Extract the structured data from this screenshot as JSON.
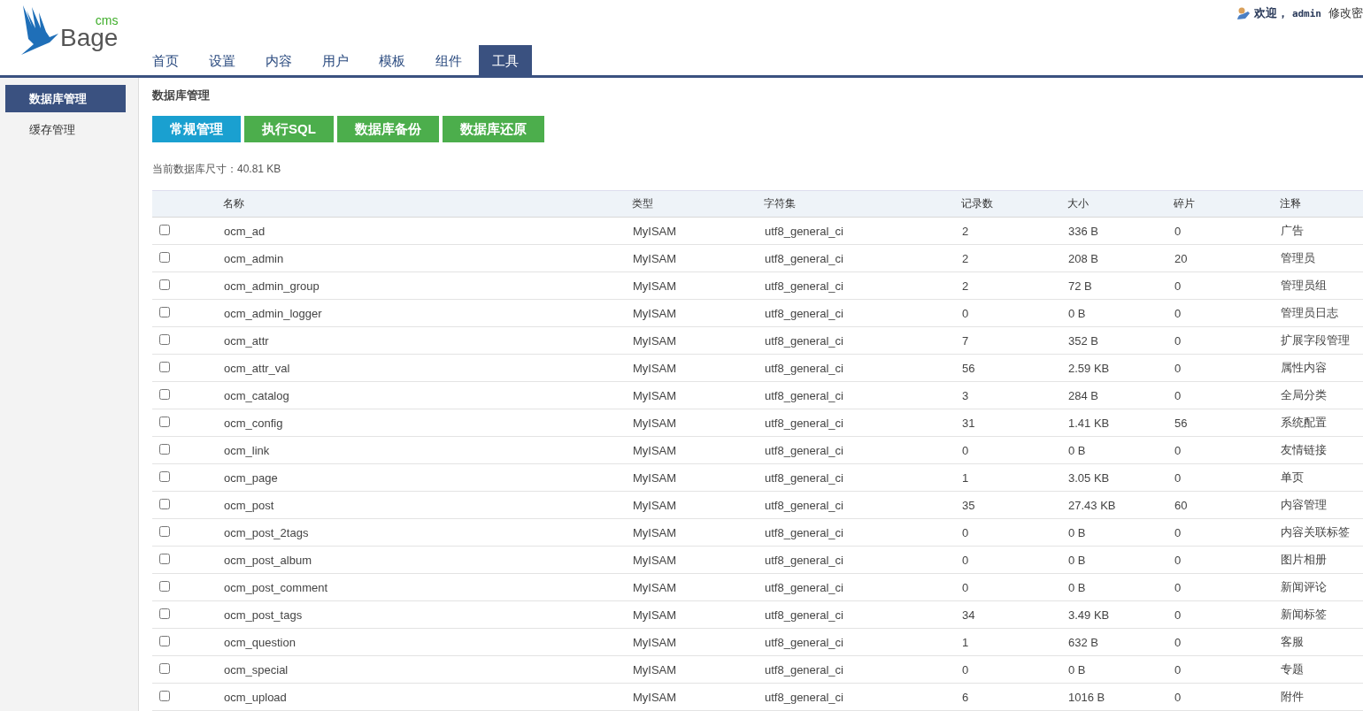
{
  "logo": {
    "text": "Bage",
    "suffix": "cms"
  },
  "user_bar": {
    "greeting": "欢迎，",
    "user": "admin",
    "link": "修改密"
  },
  "nav": [
    {
      "label": "首页",
      "selected": false
    },
    {
      "label": "设置",
      "selected": false
    },
    {
      "label": "内容",
      "selected": false
    },
    {
      "label": "用户",
      "selected": false
    },
    {
      "label": "模板",
      "selected": false
    },
    {
      "label": "组件",
      "selected": false
    },
    {
      "label": "工具",
      "selected": true
    }
  ],
  "sidebar": {
    "items": [
      {
        "label": "数据库管理",
        "selected": true
      },
      {
        "label": "缓存管理",
        "selected": false
      }
    ]
  },
  "page_title": "数据库管理",
  "actions": [
    {
      "label": "常规管理",
      "selected": true
    },
    {
      "label": "执行SQL",
      "selected": false
    },
    {
      "label": "数据库备份",
      "selected": false
    },
    {
      "label": "数据库还原",
      "selected": false
    }
  ],
  "db_size": "当前数据库尺寸：40.81 KB",
  "table": {
    "columns": [
      "名称",
      "类型",
      "字符集",
      "记录数",
      "大小",
      "碎片",
      "注释"
    ],
    "rows": [
      {
        "checked": false,
        "cells": [
          "ocm_ad",
          "MyISAM",
          "utf8_general_ci",
          "2",
          "336 B",
          "0",
          "广告"
        ]
      },
      {
        "checked": false,
        "cells": [
          "ocm_admin",
          "MyISAM",
          "utf8_general_ci",
          "2",
          "208 B",
          "20",
          "管理员"
        ]
      },
      {
        "checked": false,
        "cells": [
          "ocm_admin_group",
          "MyISAM",
          "utf8_general_ci",
          "2",
          "72 B",
          "0",
          "管理员组"
        ]
      },
      {
        "checked": false,
        "cells": [
          "ocm_admin_logger",
          "MyISAM",
          "utf8_general_ci",
          "0",
          "0 B",
          "0",
          "管理员日志"
        ]
      },
      {
        "checked": false,
        "cells": [
          "ocm_attr",
          "MyISAM",
          "utf8_general_ci",
          "7",
          "352 B",
          "0",
          "扩展字段管理"
        ]
      },
      {
        "checked": false,
        "cells": [
          "ocm_attr_val",
          "MyISAM",
          "utf8_general_ci",
          "56",
          "2.59 KB",
          "0",
          "属性内容"
        ]
      },
      {
        "checked": false,
        "cells": [
          "ocm_catalog",
          "MyISAM",
          "utf8_general_ci",
          "3",
          "284 B",
          "0",
          "全局分类"
        ]
      },
      {
        "checked": false,
        "cells": [
          "ocm_config",
          "MyISAM",
          "utf8_general_ci",
          "31",
          "1.41 KB",
          "56",
          "系统配置"
        ]
      },
      {
        "checked": false,
        "cells": [
          "ocm_link",
          "MyISAM",
          "utf8_general_ci",
          "0",
          "0 B",
          "0",
          "友情链接"
        ]
      },
      {
        "checked": false,
        "cells": [
          "ocm_page",
          "MyISAM",
          "utf8_general_ci",
          "1",
          "3.05 KB",
          "0",
          "单页"
        ]
      },
      {
        "checked": false,
        "cells": [
          "ocm_post",
          "MyISAM",
          "utf8_general_ci",
          "35",
          "27.43 KB",
          "60",
          "内容管理"
        ]
      },
      {
        "checked": false,
        "cells": [
          "ocm_post_2tags",
          "MyISAM",
          "utf8_general_ci",
          "0",
          "0 B",
          "0",
          "内容关联标签"
        ]
      },
      {
        "checked": false,
        "cells": [
          "ocm_post_album",
          "MyISAM",
          "utf8_general_ci",
          "0",
          "0 B",
          "0",
          "图片相册"
        ]
      },
      {
        "checked": false,
        "cells": [
          "ocm_post_comment",
          "MyISAM",
          "utf8_general_ci",
          "0",
          "0 B",
          "0",
          "新闻评论"
        ]
      },
      {
        "checked": false,
        "cells": [
          "ocm_post_tags",
          "MyISAM",
          "utf8_general_ci",
          "34",
          "3.49 KB",
          "0",
          "新闻标签"
        ]
      },
      {
        "checked": false,
        "cells": [
          "ocm_question",
          "MyISAM",
          "utf8_general_ci",
          "1",
          "632 B",
          "0",
          "客服"
        ]
      },
      {
        "checked": false,
        "cells": [
          "ocm_special",
          "MyISAM",
          "utf8_general_ci",
          "0",
          "0 B",
          "0",
          "专题"
        ]
      },
      {
        "checked": false,
        "cells": [
          "ocm_upload",
          "MyISAM",
          "utf8_general_ci",
          "6",
          "1016 B",
          "0",
          "附件"
        ]
      }
    ]
  }
}
